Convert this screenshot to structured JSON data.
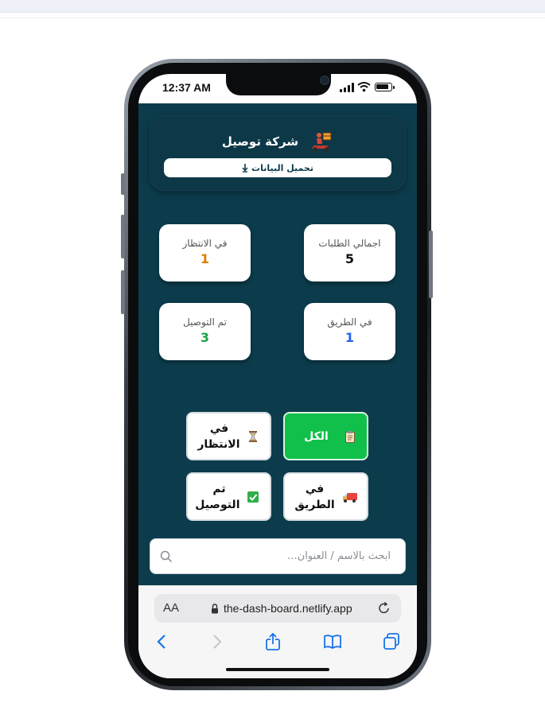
{
  "status_bar": {
    "time": "12:37 AM"
  },
  "header": {
    "company_name": "شركة توصيل",
    "load_button": "تحميل البيانات",
    "load_icon": "download-arrow-icon"
  },
  "stats": [
    {
      "label": "اجمالي الطلبات",
      "value": "5",
      "color": "#111111"
    },
    {
      "label": "في الانتظار",
      "value": "1",
      "color": "#e07b00"
    },
    {
      "label": "في الطريق",
      "value": "1",
      "color": "#2463eb"
    },
    {
      "label": "تم التوصيل",
      "value": "3",
      "color": "#1aa34a"
    }
  ],
  "filters": [
    {
      "label": "الكل",
      "icon": "clipboard-icon",
      "active": true
    },
    {
      "label": "في الانتظار",
      "icon": "hourglass-icon",
      "active": false
    },
    {
      "label": "في الطريق",
      "icon": "delivery-truck-icon",
      "active": false
    },
    {
      "label": "تم التوصيل",
      "icon": "checkbox-icon",
      "active": false
    }
  ],
  "search": {
    "placeholder": "ابحث بالاسم / العنوان..."
  },
  "browser": {
    "text_size_label": "AA",
    "url": "the-dash-board.netlify.app"
  },
  "colors": {
    "app_background": "#0c3c4c",
    "active_filter": "#11c04b",
    "pending": "#e07b00",
    "on_the_way": "#2463eb",
    "delivered": "#1aa34a"
  }
}
